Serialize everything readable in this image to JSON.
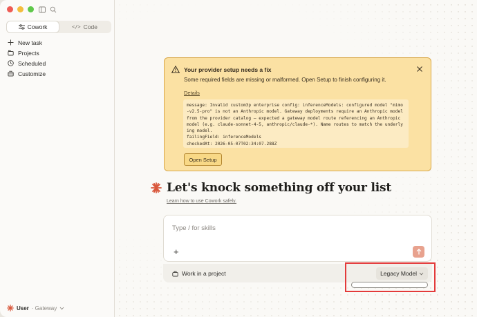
{
  "sidebar": {
    "modes": [
      {
        "label": "Cowork",
        "active": true
      },
      {
        "label": "Code",
        "active": false
      }
    ],
    "nav": [
      {
        "label": "New task",
        "icon": "plus-icon"
      },
      {
        "label": "Projects",
        "icon": "folder-icon"
      },
      {
        "label": "Scheduled",
        "icon": "clock-icon"
      },
      {
        "label": "Customize",
        "icon": "briefcase-icon"
      }
    ],
    "user": {
      "name": "User",
      "sub": "· Gateway"
    }
  },
  "banner": {
    "title": "Your provider setup needs a fix",
    "message": "Some required fields are missing or malformed. Open Setup to finish configuring it.",
    "details_label": "Details",
    "code": "message: Invalid custom3p enterprise config: inferenceModels: configured model \"mimo-v2.5-pro\" is not an Anthropic model. Gateway deployments require an Anthropic model from the provider catalog — expected a gateway model route referencing an Anthropic model (e.g. claude-sonnet-4-5, anthropic/claude-*). Name routes to match the underlying model.\nfailingField: inferenceModels\ncheckedAt: 2026-05-07T02:34:07.288Z",
    "action_label": "Open Setup",
    "colors": {
      "background": "#fbe1a3",
      "border": "#d9a84a"
    }
  },
  "hero": {
    "title": "Let's knock something off your list",
    "learn_link": "Learn how to use Cowork safely."
  },
  "composer": {
    "placeholder": "Type / for skills"
  },
  "project_bar": {
    "work_label": "Work in a project",
    "model_label": "Legacy Model"
  },
  "accent": "#d9573b",
  "highlight_color": "#e33a3a"
}
